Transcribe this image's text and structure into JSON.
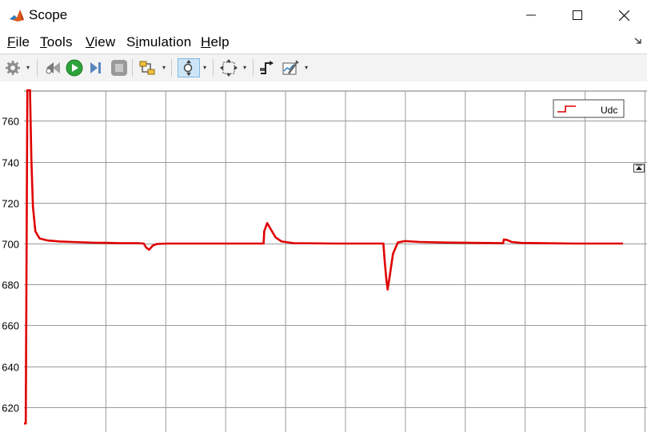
{
  "window": {
    "title": "Scope",
    "controls": {
      "minimize": "—",
      "maximize": "☐",
      "close": "✕"
    }
  },
  "menu": {
    "items": [
      {
        "pre": "",
        "u": "F",
        "post": "ile"
      },
      {
        "pre": "",
        "u": "T",
        "post": "ools"
      },
      {
        "pre": "",
        "u": "V",
        "post": "iew"
      },
      {
        "pre": "S",
        "u": "i",
        "post": "mulation"
      },
      {
        "pre": "",
        "u": "H",
        "post": "elp"
      }
    ],
    "overflow_icon": "undock-arrow-icon"
  },
  "toolbar": {
    "buttons": [
      "settings-gear-icon",
      "step-back-icon",
      "run-icon",
      "step-forward-icon",
      "stop-icon",
      "highlight-block-icon",
      "zoom-icon",
      "autoscale-icon",
      "triggers-icon",
      "measurements-icon"
    ],
    "colors": {
      "run": "#2fa33a",
      "stop": "#9a9a9a",
      "active_bg": "#cde6f7"
    }
  },
  "chart_data": {
    "type": "line",
    "title": "",
    "xlabel": "",
    "ylabel": "",
    "ylim": [
      612,
      775
    ],
    "yticks": [
      620,
      640,
      660,
      680,
      700,
      720,
      740,
      760
    ],
    "ytick_labels": [
      "620",
      "640",
      "660",
      "680",
      "700",
      "720",
      "740",
      "760"
    ],
    "grid": true,
    "legend": {
      "position": "top-right",
      "entries": [
        "Udc"
      ]
    },
    "series": [
      {
        "name": "Udc",
        "color": "#e00000",
        "points": [
          [
            0.0,
            612
          ],
          [
            0.15,
            612
          ],
          [
            0.28,
            775
          ],
          [
            0.5,
            775
          ],
          [
            0.62,
            740
          ],
          [
            0.75,
            718
          ],
          [
            0.95,
            706
          ],
          [
            1.3,
            702.5
          ],
          [
            2.0,
            701.5
          ],
          [
            3.0,
            701
          ],
          [
            4.0,
            700.8
          ],
          [
            5.0,
            700.6
          ],
          [
            6.0,
            700.4
          ],
          [
            7.0,
            700.3
          ],
          [
            8.0,
            700.2
          ],
          [
            9.5,
            700.2
          ],
          [
            10.0,
            700
          ],
          [
            10.2,
            698
          ],
          [
            10.45,
            697
          ],
          [
            10.75,
            699
          ],
          [
            11.1,
            699.8
          ],
          [
            12.0,
            700
          ],
          [
            14.0,
            700
          ],
          [
            18.0,
            700
          ],
          [
            20.0,
            700
          ],
          [
            20.05,
            706
          ],
          [
            20.3,
            710
          ],
          [
            20.6,
            707
          ],
          [
            21.0,
            703
          ],
          [
            21.5,
            701
          ],
          [
            22.5,
            700.2
          ],
          [
            26.0,
            700
          ],
          [
            30.0,
            700
          ],
          [
            30.1,
            692
          ],
          [
            30.25,
            682
          ],
          [
            30.35,
            677.5
          ],
          [
            30.5,
            683
          ],
          [
            30.8,
            695
          ],
          [
            31.2,
            700.5
          ],
          [
            31.8,
            701.2
          ],
          [
            33.0,
            700.8
          ],
          [
            35.0,
            700.5
          ],
          [
            38.0,
            700.3
          ],
          [
            40.0,
            700.2
          ],
          [
            40.05,
            702
          ],
          [
            40.3,
            701.8
          ],
          [
            40.7,
            700.8
          ],
          [
            41.5,
            700.3
          ],
          [
            44.0,
            700.1
          ],
          [
            46.0,
            700
          ],
          [
            50.0,
            700
          ]
        ]
      }
    ],
    "xlim": [
      0,
      52
    ],
    "x_grid_lines": [
      6.8,
      11.8,
      16.8,
      21.8,
      26.8,
      31.8,
      36.8,
      41.8,
      46.8,
      51.8
    ]
  }
}
